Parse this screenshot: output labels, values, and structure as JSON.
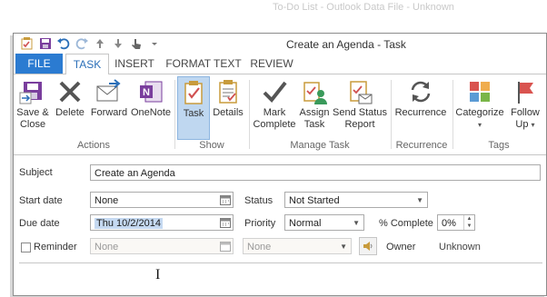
{
  "background_title": "To-Do List - Outlook Data File - Unknown",
  "window": {
    "title": "Create an Agenda - Task"
  },
  "quick_access": [
    "save-icon",
    "undo-icon",
    "redo-icon",
    "up-arrow-icon",
    "down-arrow-icon",
    "touch-mode-icon",
    "customize-icon"
  ],
  "tabs": [
    {
      "label": "FILE"
    },
    {
      "label": "TASK"
    },
    {
      "label": "INSERT"
    },
    {
      "label": "FORMAT TEXT"
    },
    {
      "label": "REVIEW"
    }
  ],
  "ribbon": {
    "actions": {
      "group_label": "Actions",
      "save_close_1": "Save &",
      "save_close_2": "Close",
      "delete": "Delete",
      "forward": "Forward",
      "onenote": "OneNote"
    },
    "show": {
      "group_label": "Show",
      "task": "Task",
      "details": "Details"
    },
    "manage": {
      "group_label": "Manage Task",
      "mark_complete_1": "Mark",
      "mark_complete_2": "Complete",
      "assign_task_1": "Assign",
      "assign_task_2": "Task",
      "send_status_1": "Send Status",
      "send_status_2": "Report"
    },
    "recurrence": {
      "group_label": "Recurrence",
      "recurrence": "Recurrence"
    },
    "tags": {
      "group_label": "Tags",
      "categorize": "Categorize",
      "follow_up_1": "Follow",
      "follow_up_2": "Up"
    }
  },
  "form": {
    "subject_label": "Subject",
    "subject_value": "Create an Agenda",
    "start_date_label": "Start date",
    "start_date_value": "None",
    "due_date_label": "Due date",
    "due_date_value": "Thu 10/2/2014",
    "status_label": "Status",
    "status_value": "Not Started",
    "priority_label": "Priority",
    "priority_value": "Normal",
    "percent_label": "% Complete",
    "percent_value": "0%",
    "reminder_label": "Reminder",
    "reminder_date_value": "None",
    "reminder_time_value": "None",
    "owner_label": "Owner",
    "owner_value": "Unknown",
    "reminder_checked": false
  },
  "colors": {
    "file_tab": "#2b7bd1",
    "selected_button": "#bfd7f0",
    "selection_highlight": "#c5d9f1"
  }
}
